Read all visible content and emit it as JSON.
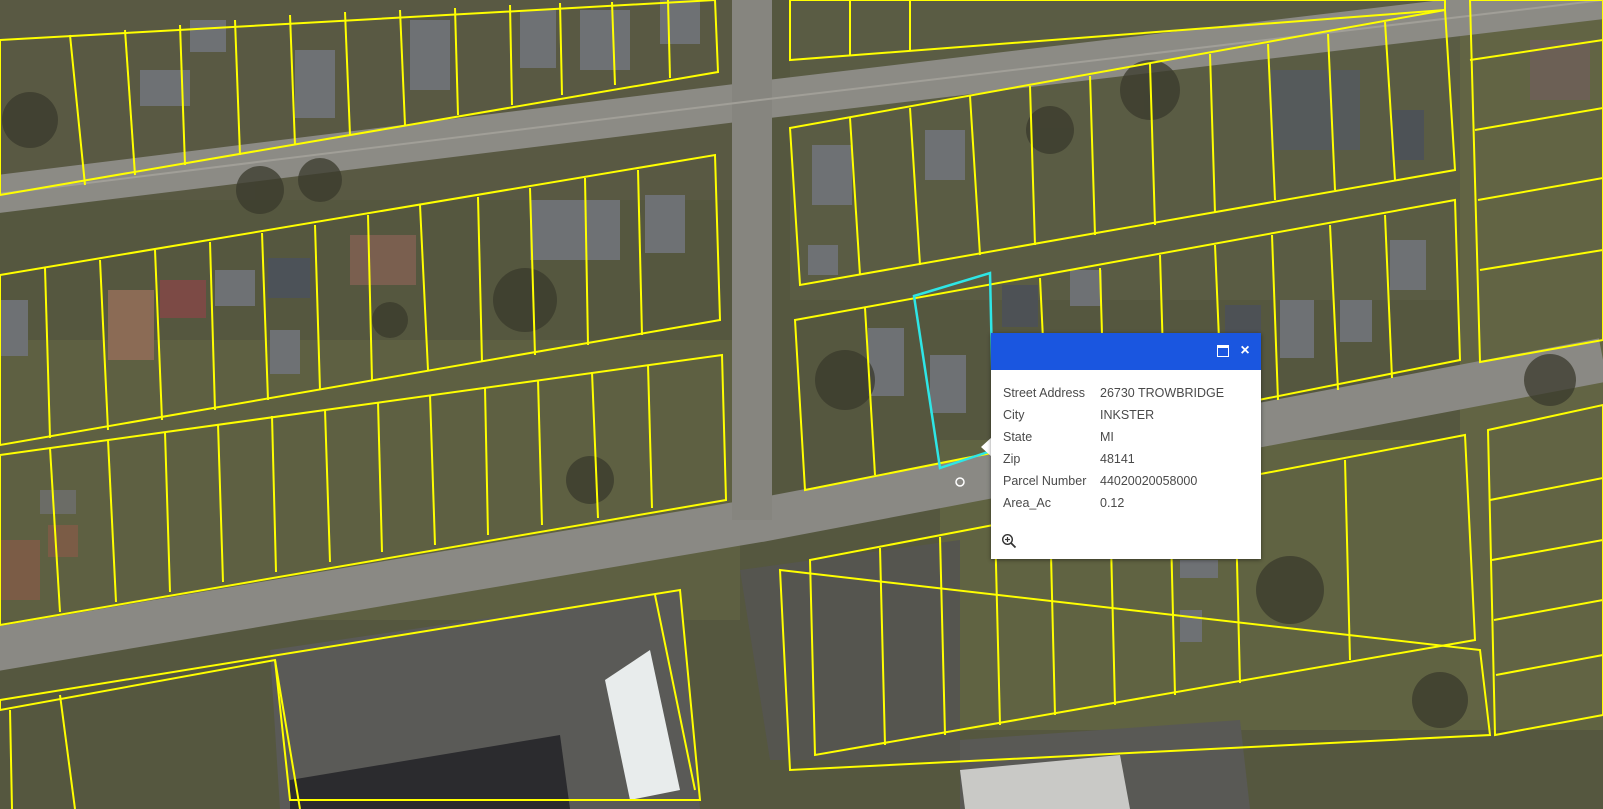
{
  "popup": {
    "header_color": "#1a56e0",
    "maximize_icon": "maximize-icon",
    "close_icon": "close-icon",
    "close_glyph": "×",
    "zoom_icon": "zoom-in-icon",
    "attributes": [
      {
        "label": "Street Address",
        "value": "26730 TROWBRIDGE"
      },
      {
        "label": "City",
        "value": "INKSTER"
      },
      {
        "label": "State",
        "value": "MI"
      },
      {
        "label": "Zip",
        "value": "48141"
      },
      {
        "label": "Parcel Number",
        "value": "44020020058000"
      },
      {
        "label": "Area_Ac",
        "value": "0.12"
      }
    ]
  },
  "map": {
    "basemap": "aerial imagery",
    "parcel_line_color": "#ffff00",
    "selected_parcel_color": "#2ee6e6"
  }
}
